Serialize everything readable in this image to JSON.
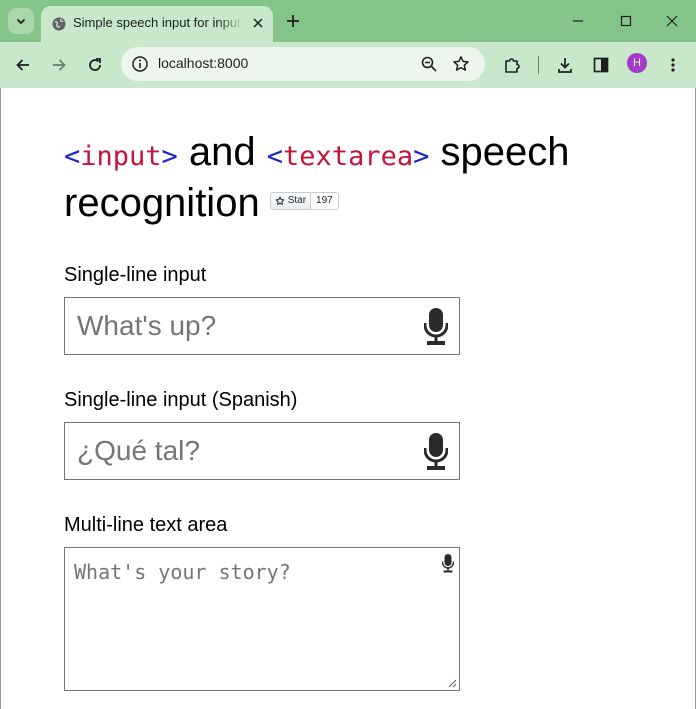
{
  "browser": {
    "tab_title": "Simple speech input for inputs and textareas",
    "url": "localhost:8000",
    "profile_initial": "H"
  },
  "page": {
    "heading_code1_open": "<",
    "heading_code1_name": "input",
    "heading_code1_close": ">",
    "heading_and": " and ",
    "heading_code2_open": "<",
    "heading_code2_name": "textarea",
    "heading_code2_close": ">",
    "heading_rest": " speech recognition",
    "star_label": "Star",
    "star_count": "197",
    "fields": [
      {
        "label": "Single-line input",
        "placeholder": "What's up?"
      },
      {
        "label": "Single-line input (Spanish)",
        "placeholder": "¿Qué tal?"
      }
    ],
    "textarea": {
      "label": "Multi-line text area",
      "placeholder": "What's your story?"
    }
  },
  "colors": {
    "chrome_frame": "#84c489",
    "chrome_toolbar": "#c9e8cb",
    "code_bracket": "#1a24c8",
    "code_name": "#c4143b",
    "avatar": "#a43ac9"
  }
}
